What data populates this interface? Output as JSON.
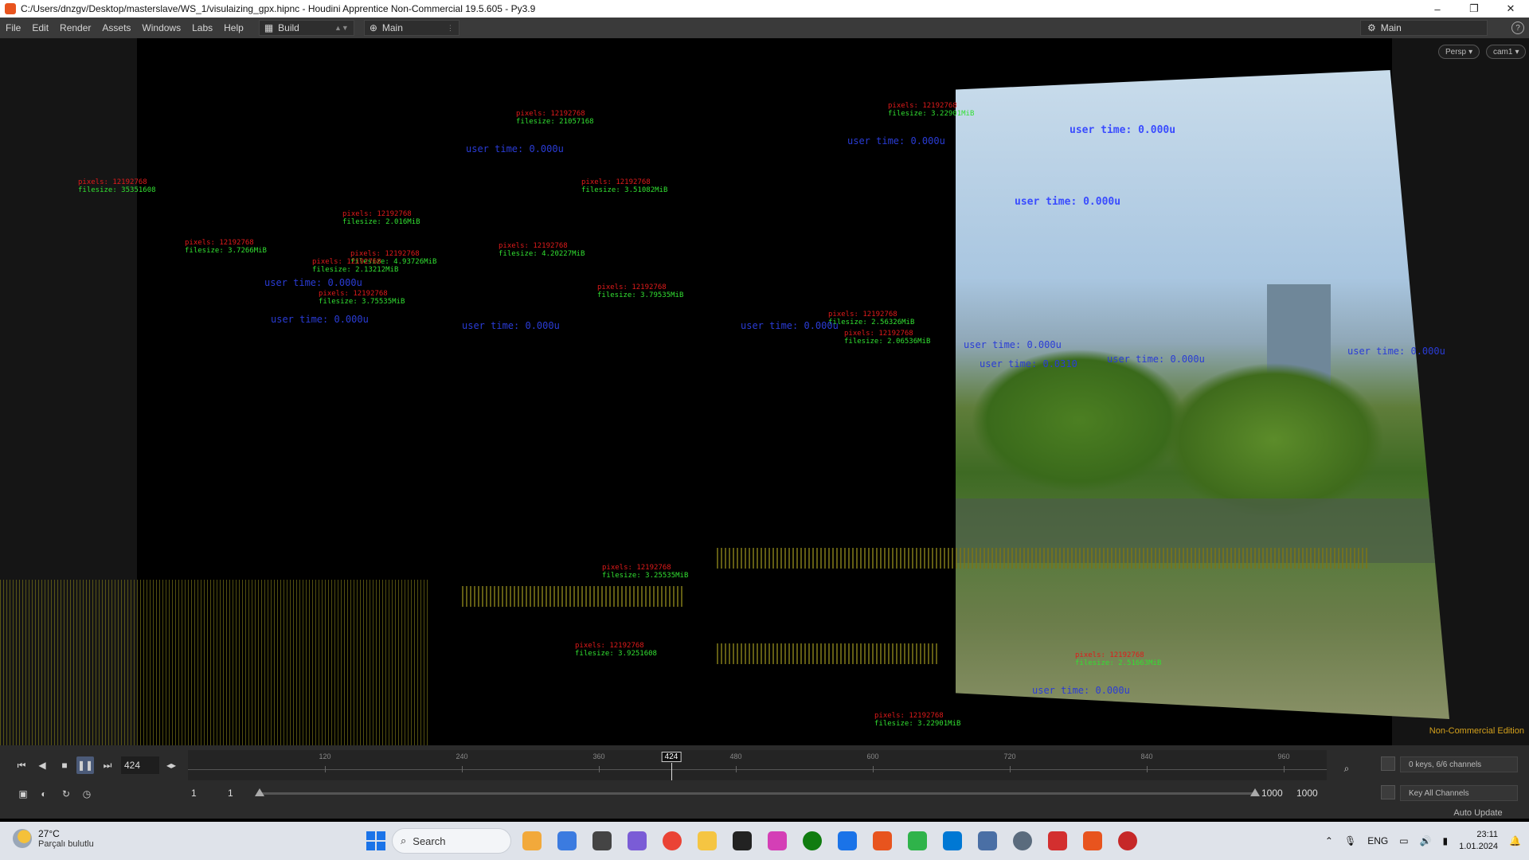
{
  "window": {
    "title": "C:/Users/dnzgv/Desktop/masterslave/WS_1/visulaizing_gpx.hipnc - Houdini Apprentice Non-Commercial 19.5.605 - Py3.9",
    "controls": {
      "minimize": "–",
      "maximize": "❐",
      "close": "✕"
    }
  },
  "menubar": {
    "items": [
      "File",
      "Edit",
      "Render",
      "Assets",
      "Windows",
      "Labs",
      "Help"
    ],
    "desktop": "Build",
    "network": "Main",
    "right_desktop": "Main",
    "help_glyph": "?"
  },
  "viewport": {
    "camera": "Persp",
    "cam": "cam1",
    "edition": "Non-Commercial Edition",
    "labels": [
      {
        "px": "pixels: 12192768",
        "fs": "filesize: 21057168"
      },
      {
        "px": "pixels: 12192768",
        "fs": "filesize: 3.22901MiB"
      },
      {
        "px": "pixels: 12192768",
        "fs": "filesize: 35351608"
      },
      {
        "px": "pixels: 12192768",
        "fs": "filesize: 3.51082MiB"
      },
      {
        "px": "pixels: 12192768",
        "fs": "filesize: 2.016MiB"
      },
      {
        "px": "pixels: 12192768",
        "fs": "filesize: 4.20227MiB"
      },
      {
        "px": "pixels: 12192768",
        "fs": "filesize: 3.7266MiB"
      },
      {
        "px": "pixels: 12192768",
        "fs": "filesize: 4.93726MiB"
      },
      {
        "px": "pixels: 12192768",
        "fs": "filesize: 2.13212MiB"
      },
      {
        "px": "pixels: 12192768",
        "fs": "filesize: 3.75535MiB"
      },
      {
        "px": "pixels: 12192768",
        "fs": "filesize: 3.79535MiB"
      },
      {
        "px": "pixels: 12192768",
        "fs": "filesize: 2.56326MiB"
      },
      {
        "px": "pixels: 12192768",
        "fs": "filesize: 2.06536MiB"
      },
      {
        "px": "pixels: 12192768",
        "fs": "filesize: 2.51663MiB"
      },
      {
        "px": "pixels: 12192768",
        "fs": "filesize: 3.9251608"
      },
      {
        "px": "pixels: 12192768",
        "fs": "filesize: 3.25535MiB"
      },
      {
        "px": "pixels: 12192768",
        "fs": "filesize: 3.22901MiB"
      }
    ],
    "user_time": [
      "user time: 0.000u",
      "user time: 0.000u",
      "user time: 0.000u",
      "user time: 0.000u",
      "user time: 0.000u",
      "user time: 0.000u",
      "user time: 0.000u",
      "user time: 0.000u",
      "user time: 0.000u",
      "user time: 0.000u",
      "user time: 0.000u",
      "user time: 0.0310",
      "user time: 0.000u"
    ]
  },
  "playbar": {
    "current_frame": "424",
    "ticks": [
      "120",
      "240",
      "360",
      "480",
      "600",
      "720",
      "840",
      "960"
    ],
    "range_start": "1",
    "range_start2": "1",
    "range_end": "1000",
    "range_end2": "1000",
    "keys_info": "0 keys, 6/6 channels",
    "key_all": "Key All Channels",
    "auto_update": "Auto Update"
  },
  "taskbar": {
    "temp": "27°C",
    "weather": "Parçalı bulutlu",
    "search": "Search",
    "lang": "ENG",
    "time": "23:11",
    "date": "1.01.2024",
    "apps": [
      "#f2a93b",
      "#3b7be0",
      "#444",
      "#7a5cd6",
      "#ea4335",
      "#f5c542",
      "#222",
      "#d43fb6",
      "#107c10",
      "#1a73e8",
      "#e8541e",
      "#2fb34a",
      "#0078d4",
      "#4a6fa5",
      "#5a6b7d",
      "#d32f2f",
      "#e8541e",
      "#c62828"
    ]
  }
}
